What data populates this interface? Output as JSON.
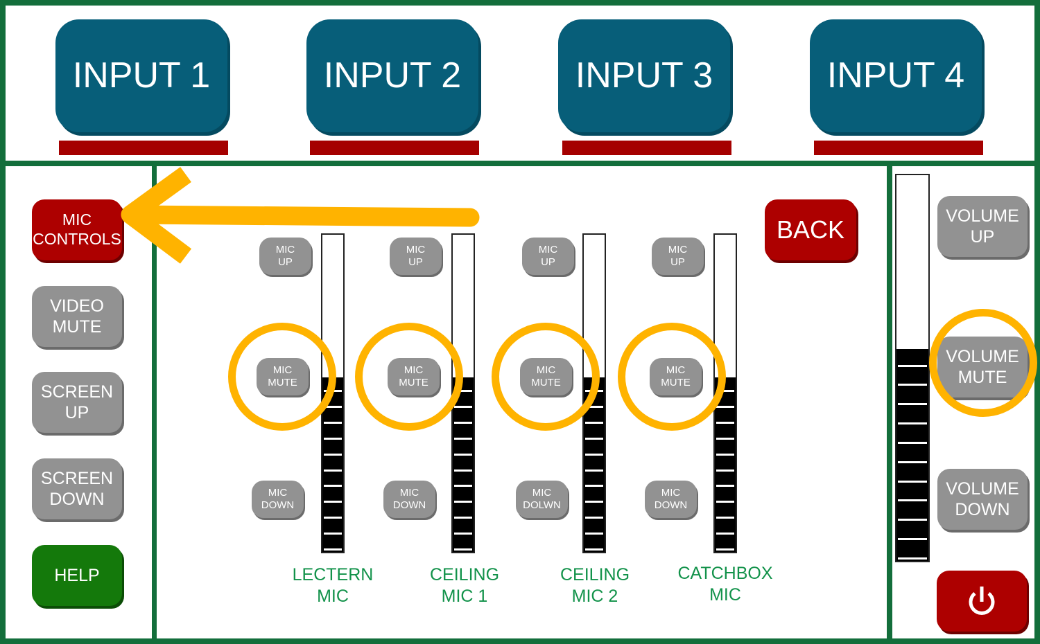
{
  "inputs": [
    {
      "label": "INPUT 1",
      "indicator": "inactive"
    },
    {
      "label": "INPUT 2",
      "indicator": "inactive"
    },
    {
      "label": "INPUT 3",
      "indicator": "inactive"
    },
    {
      "label": "INPUT 4",
      "indicator": "inactive"
    }
  ],
  "sidebar": {
    "items": [
      {
        "label": "MIC\nCONTROLS",
        "state": "active"
      },
      {
        "label": "VIDEO\nMUTE"
      },
      {
        "label": "SCREEN\nUP"
      },
      {
        "label": "SCREEN\nDOWN"
      },
      {
        "label": "HELP"
      }
    ]
  },
  "mic_controls": {
    "back_label": "BACK",
    "channels": [
      {
        "name": "LECTERN\nMIC",
        "up_label": "MIC\nUP",
        "mute_label": "MIC\nMUTE",
        "down_label": "MIC\nDOWN",
        "level_percent": 55,
        "segments": 11
      },
      {
        "name": "CEILING\nMIC 1",
        "up_label": "MIC\nUP",
        "mute_label": "MIC\nMUTE",
        "down_label": "MIC\nDOWN",
        "level_percent": 55,
        "segments": 11
      },
      {
        "name": "CEILING\nMIC 2",
        "up_label": "MIC\nUP",
        "mute_label": "MIC\nMUTE",
        "down_label": "MIC\nDOLWN",
        "level_percent": 55,
        "segments": 11
      },
      {
        "name": "CATCHBOX\nMIC",
        "up_label": "MIC\nUP",
        "mute_label": "MIC\nMUTE",
        "down_label": "MIC\nDOWN",
        "level_percent": 55,
        "segments": 11
      }
    ]
  },
  "volume": {
    "up_label": "VOLUME\nUP",
    "mute_label": "VOLUME\nMUTE",
    "down_label": "VOLUME\nDOWN",
    "level_percent": 55,
    "segments": 11,
    "power_icon": "power-icon"
  },
  "annotations": {
    "arrow": "points-to-mic-controls",
    "highlight_color": "#ffb300",
    "highlighted": [
      "mic-mute-1",
      "mic-mute-2",
      "mic-mute-3",
      "mic-mute-4",
      "volume-mute"
    ]
  },
  "colors": {
    "frame": "#136e3b",
    "input_button": "#075e79",
    "active_red": "#ad0000",
    "neutral_gray": "#929292",
    "help_green": "#14790b",
    "label_green": "#12924a"
  }
}
